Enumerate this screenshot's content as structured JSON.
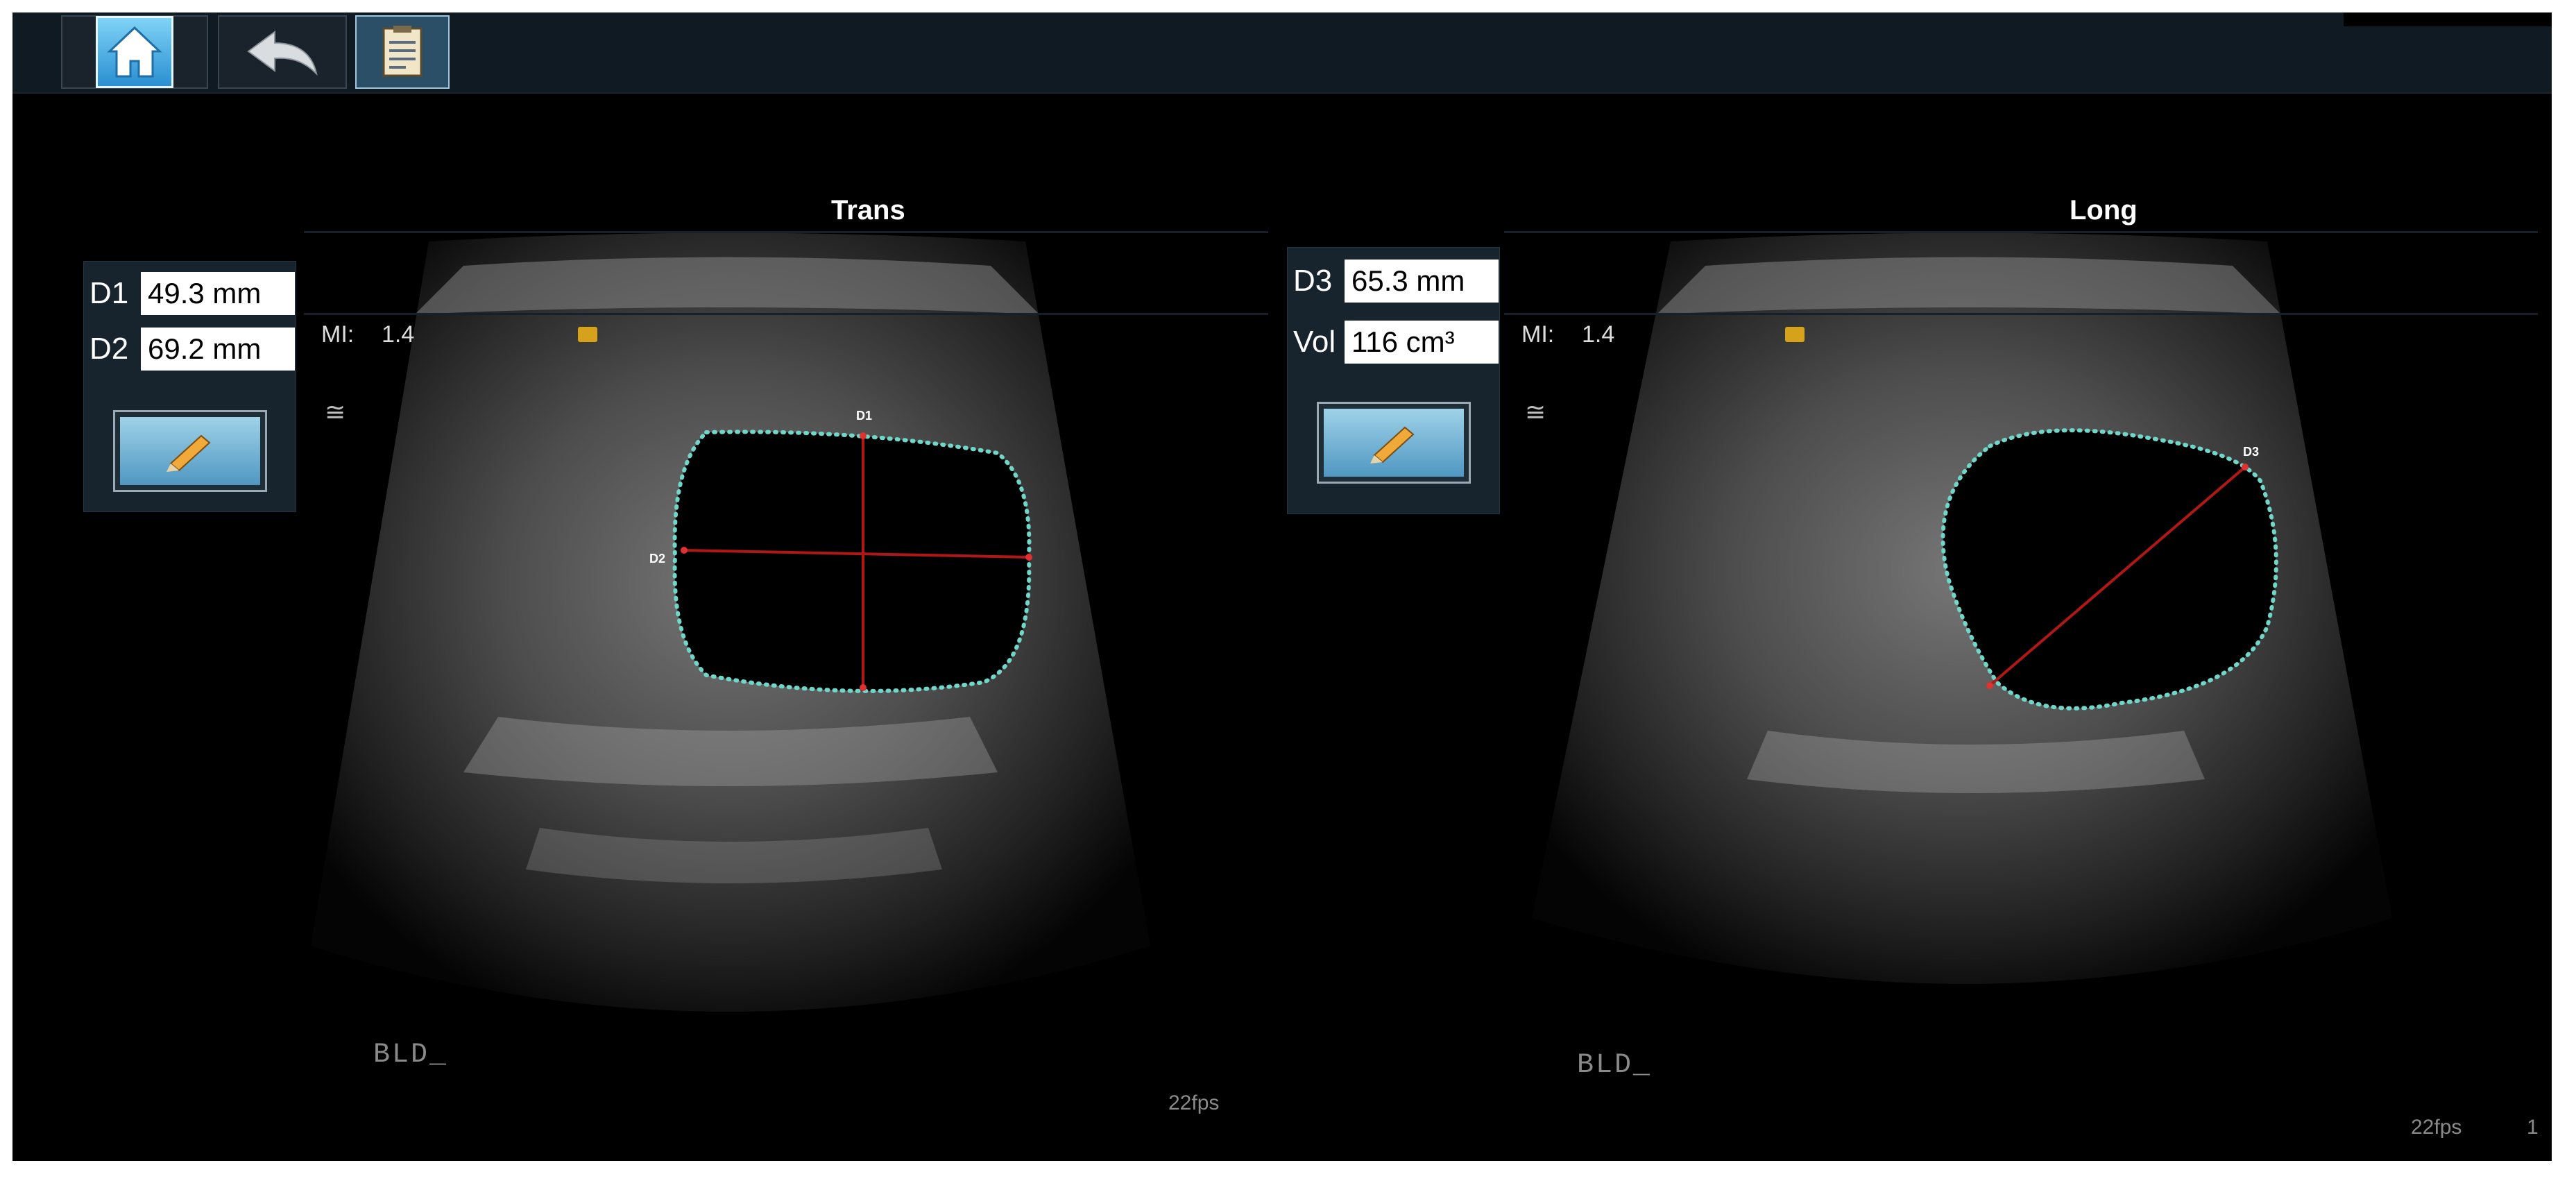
{
  "toolbar": {
    "home_label": "Home",
    "back_label": "Back",
    "report_label": "Report"
  },
  "trans": {
    "title": "Trans",
    "measurements": [
      {
        "label": "D1",
        "value": "49.3 mm"
      },
      {
        "label": "D2",
        "value": "69.2 mm"
      }
    ],
    "mi_label": "MI:",
    "mi_value": "1.4",
    "preset": "BLD_",
    "fps": "22fps",
    "calipers": [
      "D1",
      "D2"
    ]
  },
  "long": {
    "title": "Long",
    "measurements": [
      {
        "label": "D3",
        "value": "65.3 mm"
      },
      {
        "label": "Vol",
        "value": "116 cm³"
      }
    ],
    "mi_label": "MI:",
    "mi_value": "1.4",
    "preset": "BLD_",
    "fps": "22fps",
    "frame_number": "1",
    "calipers": [
      "D3"
    ]
  },
  "colors": {
    "trace": "#6fd6c8",
    "caliper": "#b01818",
    "probe_marker": "#d7a21b",
    "toolbar_bg": "#0f1a22"
  },
  "icons": [
    "home-icon",
    "undo-arrow-icon",
    "report-icon",
    "pencil-icon",
    "probe-orientation-icon",
    "wave-icon"
  ]
}
